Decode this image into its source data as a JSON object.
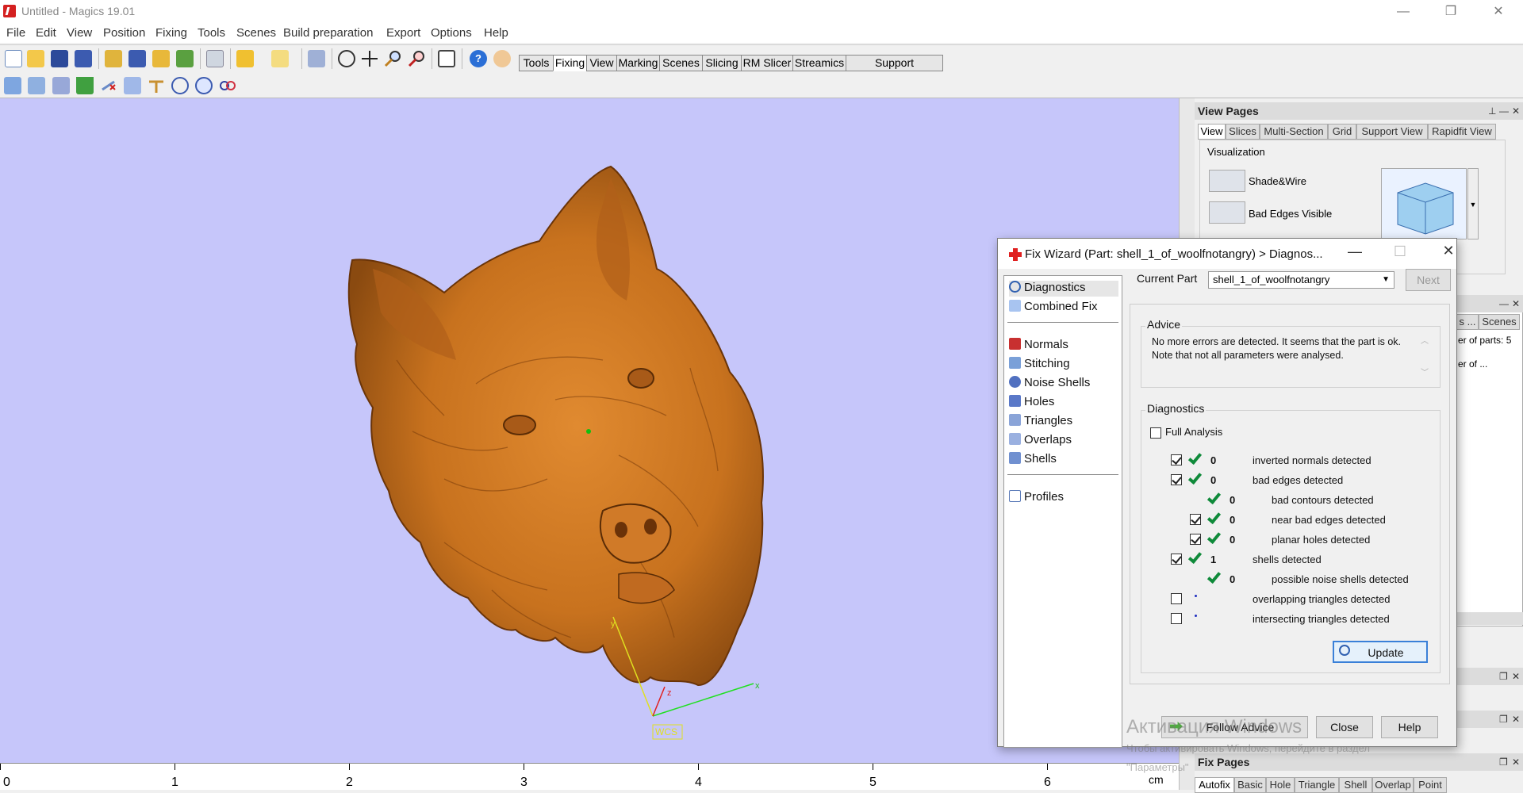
{
  "window": {
    "title": "Untitled - Magics 19.01"
  },
  "menu": [
    "File",
    "Edit",
    "View",
    "Position",
    "Fixing",
    "Tools",
    "Scenes",
    "Build preparation",
    "Export",
    "Options",
    "Help"
  ],
  "toolbar_tabs": [
    "Tools",
    "Fixing",
    "View",
    "Marking",
    "Scenes",
    "Slicing",
    "RM Slicer",
    "Streamics",
    "Support Generation"
  ],
  "toolbar_active_tab": "Fixing",
  "viewport": {
    "background": "#c6c6fa",
    "axis_labels": {
      "x": "x",
      "y": "y",
      "z": "z",
      "wcs": "WCS"
    },
    "ruler": {
      "numbers": [
        "0",
        "1",
        "2",
        "3",
        "4",
        "5",
        "6"
      ],
      "unit": "cm"
    }
  },
  "view_pages": {
    "title": "View Pages",
    "tabs": [
      "View",
      "Slices",
      "Multi-Section",
      "Grid",
      "Support View",
      "Rapidfit View"
    ],
    "section": "Visualization",
    "items": [
      "Shade&Wire",
      "Bad Edges Visible"
    ]
  },
  "parts_panel": {
    "tabs": [
      "s ...",
      "Scenes"
    ],
    "number_of_parts": "er of parts: 5",
    "column": "er of ..."
  },
  "fix_pages": {
    "title": "Fix Pages",
    "tabs": [
      "Autofix",
      "Basic",
      "Hole",
      "Triangle",
      "Shell",
      "Overlap",
      "Point"
    ]
  },
  "fix_wizard": {
    "title": "Fix Wizard (Part: shell_1_of_woolfnotangry) > Diagnos...",
    "nav": {
      "group1": [
        "Diagnostics",
        "Combined Fix"
      ],
      "group2": [
        "Normals",
        "Stitching",
        "Noise Shells",
        "Holes",
        "Triangles",
        "Overlaps",
        "Shells"
      ],
      "group3": [
        "Profiles"
      ]
    },
    "current_part_label": "Current Part",
    "current_part_value": "shell_1_of_woolfnotangry",
    "next_button": "Next",
    "advice_title": "Advice",
    "advice_text": "No more errors are detected. It seems that the part is ok. Note that not all parameters were analysed.",
    "diagnostics_title": "Diagnostics",
    "full_analysis_label": "Full Analysis",
    "rows": [
      {
        "checkbox": true,
        "checked": true,
        "status": "ok",
        "count": "0",
        "label": "inverted normals detected",
        "indent": 0
      },
      {
        "checkbox": true,
        "checked": true,
        "status": "ok",
        "count": "0",
        "label": "bad edges detected",
        "indent": 0
      },
      {
        "checkbox": false,
        "checked": false,
        "status": "ok",
        "count": "0",
        "label": "bad contours detected",
        "indent": 1
      },
      {
        "checkbox": true,
        "checked": true,
        "status": "ok",
        "count": "0",
        "label": "near bad edges detected",
        "indent": 1
      },
      {
        "checkbox": true,
        "checked": true,
        "status": "ok",
        "count": "0",
        "label": "planar holes detected",
        "indent": 1
      },
      {
        "checkbox": true,
        "checked": true,
        "status": "ok",
        "count": "1",
        "label": "shells detected",
        "indent": 0
      },
      {
        "checkbox": false,
        "checked": false,
        "status": "ok",
        "count": "0",
        "label": "possible noise shells detected",
        "indent": 1
      },
      {
        "checkbox": true,
        "checked": false,
        "status": "dot",
        "count": "",
        "label": "overlapping triangles detected",
        "indent": 0
      },
      {
        "checkbox": true,
        "checked": false,
        "status": "dot",
        "count": "",
        "label": "intersecting triangles detected",
        "indent": 0
      }
    ],
    "update_button": "Update",
    "follow_advice_button": "Follow Advice",
    "close_button": "Close",
    "help_button": "Help"
  },
  "watermark": {
    "line1": "Активация Windows",
    "line2": "Чтобы активировать Windows, перейдите в раздел",
    "line3": "\"Параметры\""
  }
}
